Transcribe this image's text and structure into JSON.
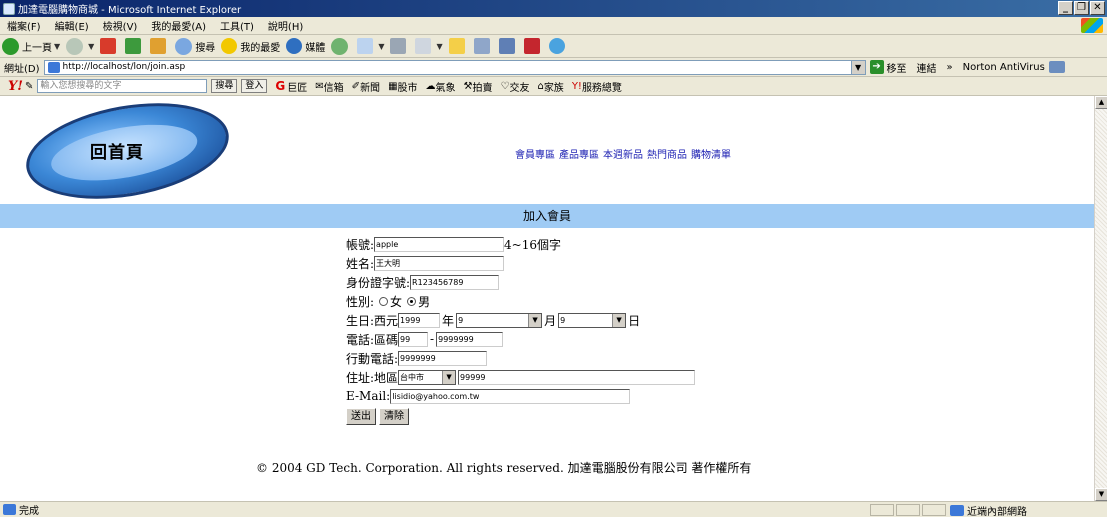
{
  "window": {
    "title": "加達電腦購物商城 - Microsoft Internet Explorer",
    "min": "_",
    "max": "❐",
    "close": "✕"
  },
  "menu": [
    "檔案(F)",
    "編輯(E)",
    "檢視(V)",
    "我的最愛(A)",
    "工具(T)",
    "說明(H)"
  ],
  "toolbar": {
    "back": "上一頁",
    "search": "搜尋",
    "favorites": "我的最愛",
    "media": "媒體"
  },
  "address": {
    "label": "網址(D)",
    "url": "http://localhost/lon/join.asp",
    "go": "移至",
    "links": "連結",
    "extra": "»",
    "antivirus": "Norton AntiVirus"
  },
  "yahoo": {
    "search_placeholder": "輸入您想搜尋的文字",
    "search_button": "搜尋",
    "signin": "登入",
    "items": [
      "巨匠",
      "信箱",
      "新聞",
      "股市",
      "氣象",
      "拍賣",
      "交友",
      "家族",
      "服務總覽"
    ]
  },
  "page": {
    "logo_text": "回首頁",
    "nav": [
      "會員專區",
      "產品專區",
      "本週新品",
      "熱門商品",
      "購物清單"
    ],
    "section_title": "加入會員",
    "form": {
      "account_label": "帳號:",
      "account_value": "apple",
      "account_hint": "4~16個字",
      "name_label": "姓名:",
      "name_value": "王大明",
      "id_label": "身份證字號:",
      "id_value": "R123456789",
      "gender_label": "性別:",
      "gender_female": "女",
      "gender_male": "男",
      "gender_selected": "男",
      "birthday_label": "生日:西元",
      "birth_year": "1999",
      "year_label": "年",
      "birth_month": "9",
      "month_label": "月",
      "birth_day": "9",
      "day_label": "日",
      "phone_label": "電話:區碼",
      "phone_area": "99",
      "phone_sep": "-",
      "phone_number": "9999999",
      "mobile_label": "行動電話:",
      "mobile_value": "9999999",
      "address_label": "住址:地區",
      "region_value": "台中市",
      "address_value": "99999",
      "email_label": "E-Mail:",
      "email_value": "lisidio@yahoo.com.tw",
      "submit": "送出",
      "reset": "清除"
    },
    "footer": "© 2004 GD Tech. Corporation. All rights reserved. 加達電腦股份有限公司 著作權所有"
  },
  "status": {
    "text": "完成",
    "zone": "近端內部網路"
  }
}
